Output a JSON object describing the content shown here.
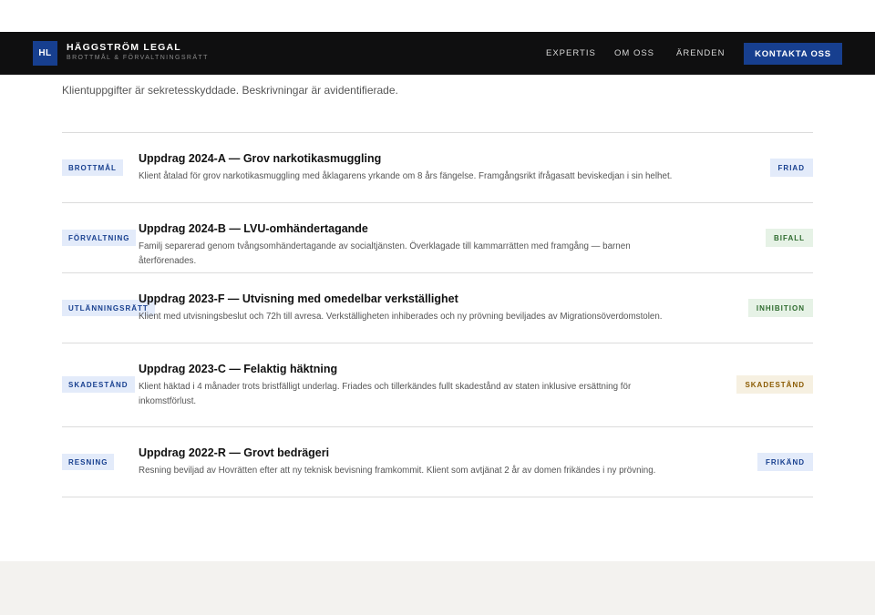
{
  "header": {
    "logo": "HL",
    "brand": "HÄGGSTRÖM LEGAL",
    "tagline": "BROTTMÅL & FÖRVALTNINGSRÄTT",
    "nav": [
      "EXPERTIS",
      "OM OSS",
      "ÄRENDEN"
    ],
    "cta": "KONTAKTA OSS"
  },
  "notice": "Klientuppgifter är sekretesskyddade. Beskrivningar är avidentifierade.",
  "cases": [
    {
      "tag": "BROTTMÅL",
      "title": "Uppdrag 2024-A — Grov narkotikasmuggling",
      "desc": "Klient åtalad för grov narkotikasmuggling med åklagarens yrkande om 8 års fängelse. Framgångsrikt ifrågasatt beviskedjan i sin helhet.",
      "status": "FRIAD",
      "status_bg": "#e3ebfa",
      "status_fg": "#173f8f"
    },
    {
      "tag": "FÖRVALTNING",
      "title": "Uppdrag 2024-B — LVU-omhändertagande",
      "desc": "Familj separerad genom tvångsomhändertagande av socialtjänsten. Överklagade till kammarrätten med framgång — barnen återförenades.",
      "status": "BIFALL",
      "status_bg": "#e6f2e6",
      "status_fg": "#2e6b2e"
    },
    {
      "tag": "UTLÄNNINGSRÄTT",
      "title": "Uppdrag 2023-F — Utvisning med omedelbar verkställighet",
      "desc": "Klient med utvisningsbeslut och 72h till avresa. Verkställigheten inhiberades och ny prövning beviljades av Migrationsöverdomstolen.",
      "status": "INHIBITION",
      "status_bg": "#e6f2e6",
      "status_fg": "#2e6b2e"
    },
    {
      "tag": "SKADESTÅND",
      "title": "Uppdrag 2023-C — Felaktig häktning",
      "desc": "Klient häktad i 4 månader trots bristfälligt underlag. Friades och tillerkändes fullt skadestånd av staten inklusive ersättning för inkomstförlust.",
      "status": "SKADESTÅND",
      "status_bg": "#f6f0e1",
      "status_fg": "#8a5a00"
    },
    {
      "tag": "RESNING",
      "title": "Uppdrag 2022-R — Grovt bedrägeri",
      "desc": "Resning beviljad av Hovrätten efter att ny teknisk bevisning framkommit. Klient som avtjänat 2 år av domen frikändes i ny prövning.",
      "status": "FRIKÄND",
      "status_bg": "#e3ebfa",
      "status_fg": "#173f8f"
    }
  ]
}
